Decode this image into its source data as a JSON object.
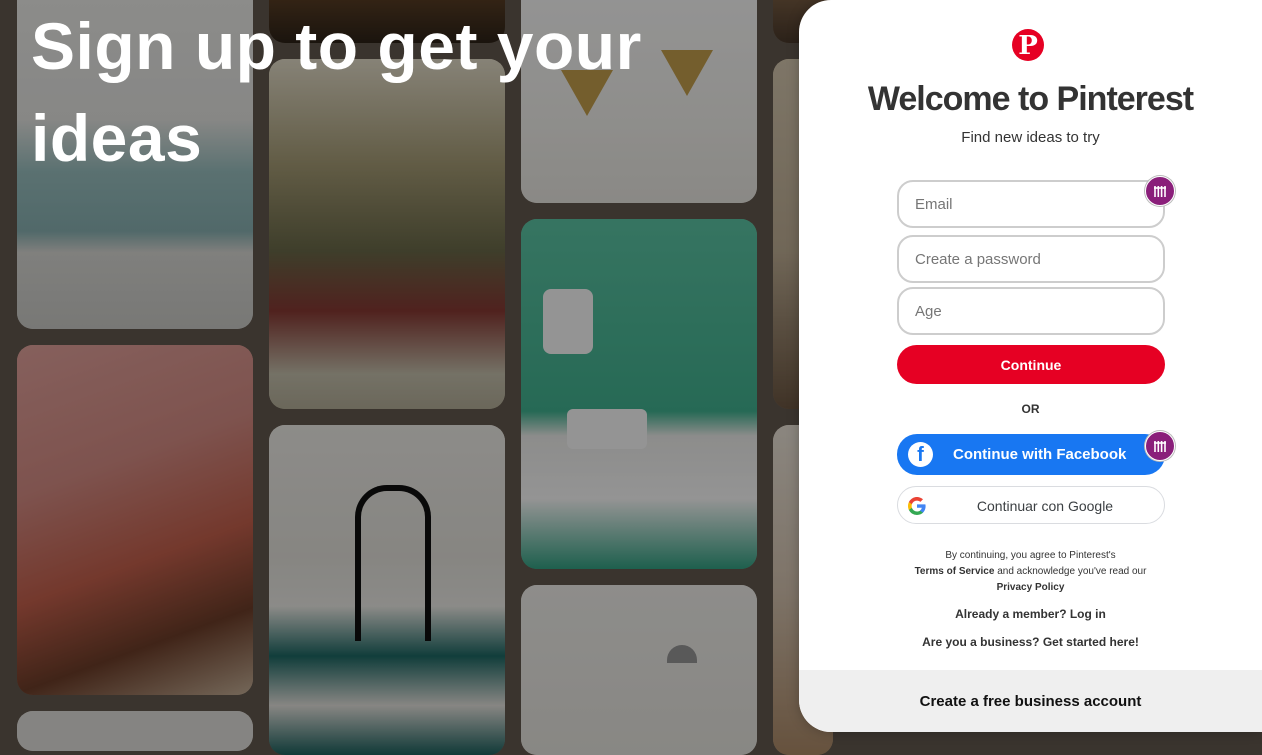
{
  "hero": {
    "title": "Sign up to get your ideas"
  },
  "card": {
    "logo_letter": "P",
    "title": "Welcome to Pinterest",
    "subtitle": "Find new ideas to try",
    "email_placeholder": "Email",
    "password_placeholder": "Create a password",
    "age_placeholder": "Age",
    "continue_label": "Continue",
    "or_label": "OR",
    "facebook_label": "Continue with Facebook",
    "google_label": "Continuar con Google",
    "terms_prefix": "By continuing, you agree to Pinterest's",
    "terms_link": "Terms of Service",
    "terms_middle": "and acknowledge you've read our",
    "privacy_link": "Privacy Policy",
    "already_member": "Already a member? Log in",
    "business_question": "Are you a business?  Get started here!",
    "business_account": "Create a free business account"
  },
  "colors": {
    "brand_red": "#e60023",
    "facebook_blue": "#1877f2",
    "extension_badge": "#8a1f7a"
  },
  "icons": [
    "pinterest-logo-icon",
    "facebook-icon",
    "google-icon",
    "password-manager-icon"
  ]
}
